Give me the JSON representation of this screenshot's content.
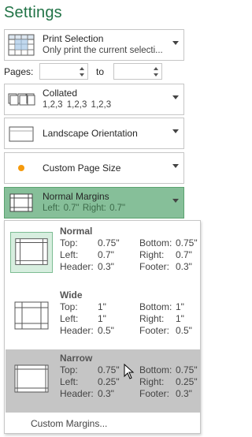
{
  "header": {
    "title": "Settings"
  },
  "print_what": {
    "label": "Print Selection",
    "sub": "Only print the current selecti...",
    "icon": "print-selection-icon"
  },
  "pages": {
    "label": "Pages:",
    "from_value": "",
    "to_label": "to",
    "to_value": ""
  },
  "collation": {
    "label": "Collated",
    "sub": "1,2,3    1,2,3    1,2,3",
    "icon": "collated-pages-icon"
  },
  "orientation": {
    "label": "Landscape Orientation",
    "icon": "landscape-page-icon"
  },
  "paper_size": {
    "label": "Custom Page Size",
    "icon": "orange-dot-icon"
  },
  "margins": {
    "label": "Normal Margins",
    "sub": "Left:  0.7\"    Right:  0.7\"",
    "icon": "margins-icon"
  },
  "margin_options": [
    {
      "name": "Normal",
      "top_label": "Top:",
      "top": "0.75\"",
      "bottom_label": "Bottom:",
      "bottom": "0.75\"",
      "left_label": "Left:",
      "left": "0.7\"",
      "right_label": "Right:",
      "right": "0.7\"",
      "header_label": "Header:",
      "header": "0.3\"",
      "footer_label": "Footer:",
      "footer": "0.3\""
    },
    {
      "name": "Wide",
      "top_label": "Top:",
      "top": "1\"",
      "bottom_label": "Bottom:",
      "bottom": "1\"",
      "left_label": "Left:",
      "left": "1\"",
      "right_label": "Right:",
      "right": "1\"",
      "header_label": "Header:",
      "header": "0.5\"",
      "footer_label": "Footer:",
      "footer": "0.5\""
    },
    {
      "name": "Narrow",
      "top_label": "Top:",
      "top": "0.75\"",
      "bottom_label": "Bottom:",
      "bottom": "0.75\"",
      "left_label": "Left:",
      "left": "0.25\"",
      "right_label": "Right:",
      "right": "0.25\"",
      "header_label": "Header:",
      "header": "0.3\"",
      "footer_label": "Footer:",
      "footer": "0.3\""
    }
  ],
  "custom_margins_label": "Custom Margins...",
  "colors": {
    "accent": "#217346",
    "active_fill": "#86bf99",
    "hover_fill": "#c5c5c5"
  }
}
